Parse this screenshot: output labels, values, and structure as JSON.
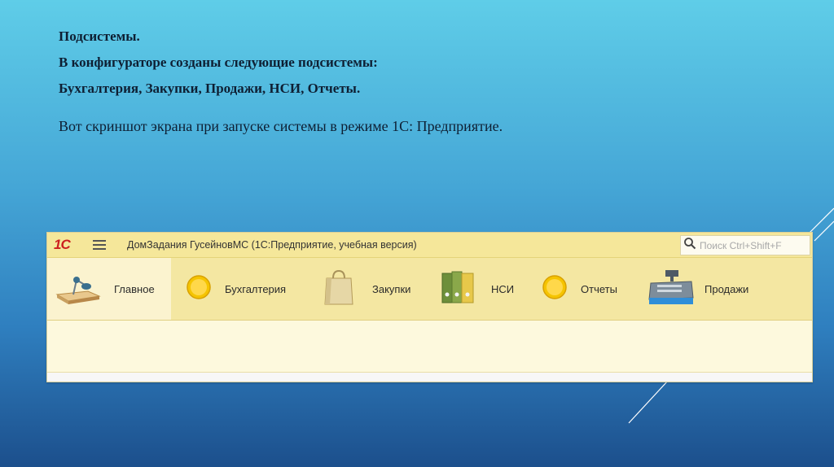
{
  "slide": {
    "line1": "Подсистемы.",
    "line2": "В конфигураторе созданы следующие подсистемы:",
    "line3": "Бухгалтерия,  Закупки,  Продажи, НСИ, Отчеты.",
    "line4": "Вот  скриншот экрана при запуске системы в режиме 1С: Предприятие."
  },
  "window": {
    "logo": "1С",
    "title": "ДомЗадания ГусейновМС  (1С:Предприятие, учебная версия)",
    "search_placeholder": "Поиск Ctrl+Shift+F",
    "sections": [
      {
        "label": "Главное",
        "icon": "desk-lamp-icon"
      },
      {
        "label": "Бухгалтерия",
        "icon": "yellow-circle-icon"
      },
      {
        "label": "Закупки",
        "icon": "shopping-bag-icon"
      },
      {
        "label": "НСИ",
        "icon": "binders-icon"
      },
      {
        "label": "Отчеты",
        "icon": "yellow-circle-icon"
      },
      {
        "label": "Продажи",
        "icon": "cash-register-icon"
      }
    ]
  },
  "colors": {
    "accent": "#cc1f1f",
    "panel": "#f4e7a2",
    "background_top": "#5fcde8",
    "background_bottom": "#1c4f8c"
  }
}
